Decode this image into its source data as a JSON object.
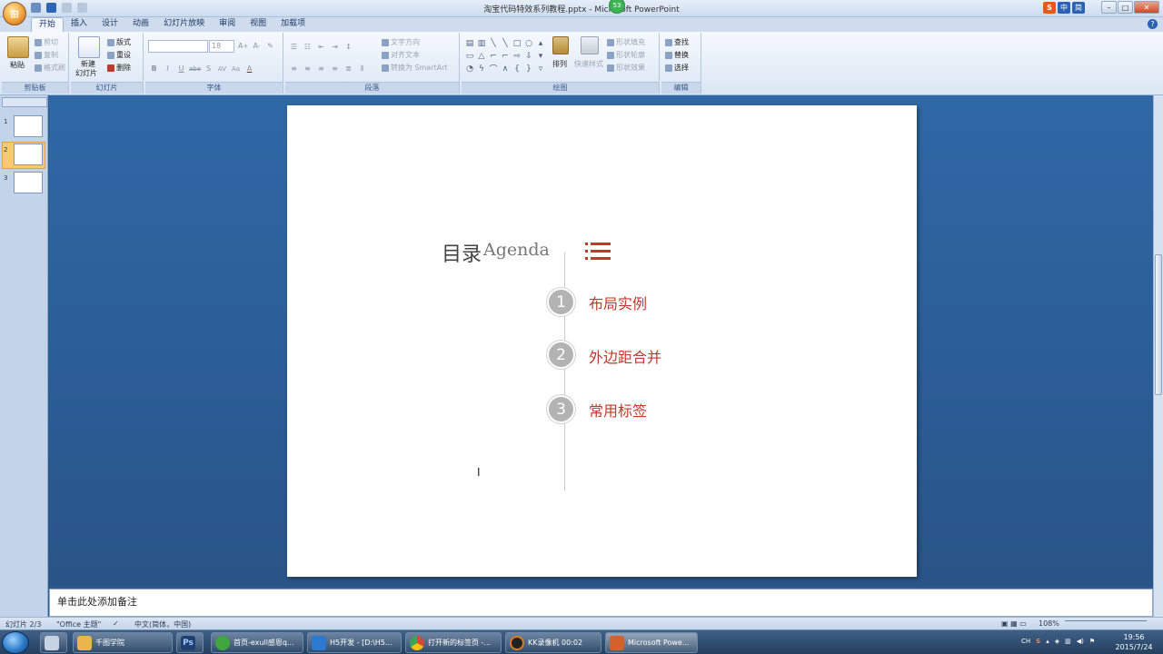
{
  "window": {
    "title": "淘宝代码特效系列教程.pptx - Microsoft PowerPoint",
    "badge": "53",
    "ime": [
      "S",
      "中",
      "简"
    ]
  },
  "ribbon_tabs": [
    "开始",
    "插入",
    "设计",
    "动画",
    "幻灯片放映",
    "审阅",
    "视图",
    "加载项"
  ],
  "groups": {
    "clipboard": {
      "label": "剪贴板",
      "paste": "粘贴",
      "cut": "剪切",
      "copy": "复制",
      "format_painter": "格式刷"
    },
    "slides": {
      "label": "幻灯片",
      "new_slide": "新建",
      "new_slide2": "幻灯片",
      "layout": "版式",
      "reset": "重设",
      "delete": "删除"
    },
    "font": {
      "label": "字体",
      "size": "18",
      "buttons": [
        "B",
        "I",
        "U",
        "abe",
        "S",
        "AV",
        "Aa",
        "A"
      ]
    },
    "paragraph": {
      "label": "段落",
      "text_direction": "文字方向",
      "align_text": "对齐文本",
      "smartart": "转换为 SmartArt"
    },
    "drawing": {
      "label": "绘图",
      "arrange": "排列",
      "quick_styles": "快速样式",
      "shape_fill": "形状填充",
      "shape_outline": "形状轮廓",
      "shape_effects": "形状效果"
    },
    "editing": {
      "label": "编辑",
      "find": "查找",
      "replace": "替换",
      "select": "选择"
    }
  },
  "slide": {
    "title_cn": "目录",
    "title_en": "Agenda",
    "items": [
      {
        "num": "1",
        "text": "布局实例"
      },
      {
        "num": "2",
        "text": "外边距合并"
      },
      {
        "num": "3",
        "text": "常用标签"
      }
    ]
  },
  "thumbnails": [
    "1",
    "2",
    "3"
  ],
  "notes_placeholder": "单击此处添加备注",
  "status": {
    "slide_count": "幻灯片 2/3",
    "theme": "\"Office 主题\"",
    "language": "中文(简体，中国)",
    "zoom": "108%"
  },
  "taskbar": {
    "items": [
      {
        "label": "千图学院",
        "color": "#e8b64a"
      },
      {
        "label": "",
        "color": "#1f3f73"
      },
      {
        "label": "首页-exull感恩q...",
        "color": "#3ea83e"
      },
      {
        "label": "H5开发 - [D:\\H5...",
        "color": "#2b7ad0"
      },
      {
        "label": "打开新的标签页 -...",
        "color": "#d9473a"
      },
      {
        "label": "KK录像机 00:02",
        "color": "#222222"
      },
      {
        "label": "Microsoft Powe...",
        "color": "#d4602a"
      }
    ],
    "ps_label": "Ps",
    "tray_text": "CH",
    "time": "19:56",
    "date": "2015/7/24"
  }
}
